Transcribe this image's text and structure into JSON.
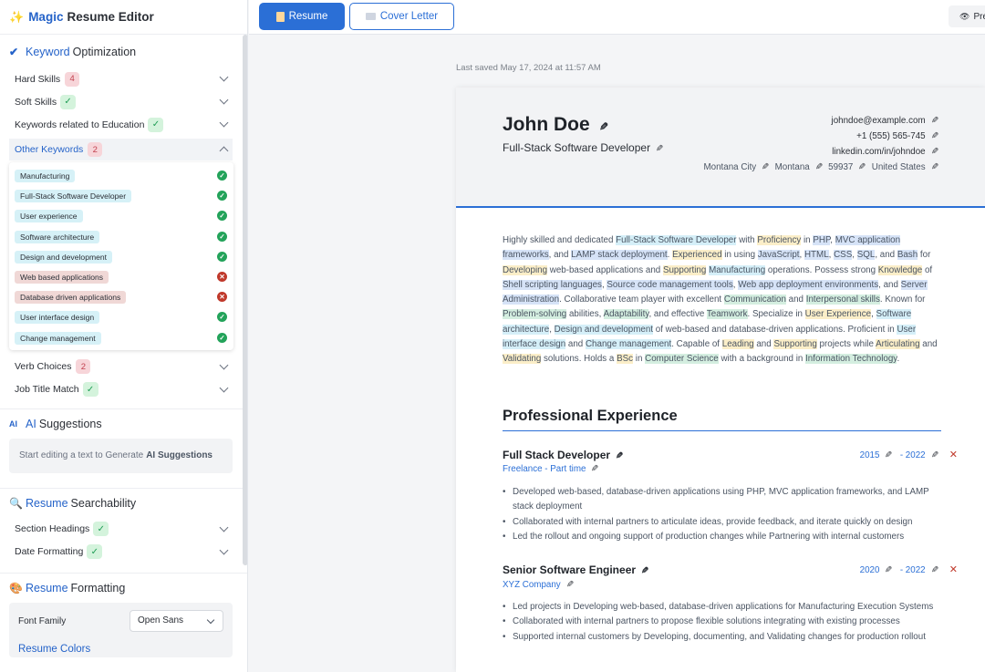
{
  "brand": {
    "prefix": "Magic",
    "rest": "Resume Editor"
  },
  "keyword_section": {
    "title_blue": "Keyword",
    "title_rest": "Optimization",
    "items": [
      {
        "label": "Hard Skills",
        "badge": "4",
        "status": "count"
      },
      {
        "label": "Soft Skills",
        "badge": "✓",
        "status": "ok"
      },
      {
        "label": "Keywords related to Education",
        "badge": "✓",
        "status": "ok"
      },
      {
        "label": "Other Keywords",
        "badge": "2",
        "status": "count",
        "expanded": true
      }
    ],
    "other_keywords": [
      {
        "tag": "Manufacturing",
        "ok": true
      },
      {
        "tag": "Full-Stack Software Developer",
        "ok": true
      },
      {
        "tag": "User experience",
        "ok": true
      },
      {
        "tag": "Software architecture",
        "ok": true
      },
      {
        "tag": "Design and development",
        "ok": true
      },
      {
        "tag": "Web based applications",
        "ok": false
      },
      {
        "tag": "Database driven applications",
        "ok": false
      },
      {
        "tag": "User interface design",
        "ok": true
      },
      {
        "tag": "Change management",
        "ok": true
      }
    ],
    "after_items": [
      {
        "label": "Verb Choices",
        "badge": "2",
        "status": "count"
      },
      {
        "label": "Job Title Match",
        "badge": "✓",
        "status": "ok"
      }
    ]
  },
  "ai_section": {
    "title_blue": "AI",
    "title_rest": "Suggestions",
    "hint": "Start editing a text to Generate",
    "hint_bold": "AI Suggestions"
  },
  "search_section": {
    "title_blue": "Resume",
    "title_rest": "Searchability",
    "items": [
      {
        "label": "Section Headings",
        "badge": "✓"
      },
      {
        "label": "Date Formatting",
        "badge": "✓"
      }
    ]
  },
  "format_section": {
    "title_blue": "Resume",
    "title_rest": "Formatting",
    "font_family_label": "Font Family",
    "font_family_value": "Open Sans",
    "colors_label": "Resume Colors"
  },
  "topbar": {
    "resume_tab": "Resume",
    "cover_tab": "Cover Letter",
    "preview": "Pre"
  },
  "last_saved": "Last saved May 17, 2024 at 11:57 AM",
  "resume": {
    "name": "John Doe",
    "role": "Full-Stack Software Developer",
    "email": "johndoe@example.com",
    "phone": "+1 (555) 565-745",
    "linkedin": "linkedin.com/in/johndoe",
    "city": "Montana City",
    "state": "Montana",
    "zip": "59937",
    "country": "United States",
    "experience_heading": "Professional Experience",
    "jobs": [
      {
        "title": "Full Stack Developer",
        "company": "Freelance - Part time",
        "start": "2015",
        "end": "- 2022",
        "bullets": [
          "Developed web-based, database-driven applications using PHP, MVC application frameworks, and LAMP stack deployment",
          "Collaborated with internal partners to articulate ideas, provide feedback, and iterate quickly on design",
          "Led the rollout and ongoing support of production changes while Partnering with internal customers"
        ]
      },
      {
        "title": "Senior Software Engineer",
        "company": "XYZ Company",
        "start": "2020",
        "end": "- 2022",
        "bullets": [
          "Led projects in Developing web-based, database-driven applications for Manufacturing Execution Systems",
          "Collaborated with internal partners to propose flexible solutions integrating with existing processes",
          "Supported internal customers by Developing, documenting, and Validating changes for production rollout"
        ]
      }
    ]
  },
  "summary_segments": [
    [
      "Highly skilled and dedicated ",
      ""
    ],
    [
      "Full-Stack Software Developer",
      "c"
    ],
    [
      " with ",
      ""
    ],
    [
      "Proficiency",
      "y"
    ],
    [
      " in ",
      ""
    ],
    [
      "PHP",
      "b"
    ],
    [
      ", ",
      ""
    ],
    [
      "MVC application frameworks",
      "b"
    ],
    [
      ", and ",
      ""
    ],
    [
      "LAMP stack deployment",
      "b"
    ],
    [
      ". ",
      ""
    ],
    [
      "Experienced",
      "y"
    ],
    [
      " in using ",
      ""
    ],
    [
      "JavaScript",
      "b"
    ],
    [
      ", ",
      ""
    ],
    [
      "HTML",
      "b"
    ],
    [
      ", ",
      ""
    ],
    [
      "CSS",
      "b"
    ],
    [
      ", ",
      ""
    ],
    [
      "SQL",
      "b"
    ],
    [
      ", and ",
      ""
    ],
    [
      "Bash",
      "b"
    ],
    [
      " for ",
      ""
    ],
    [
      "Developing",
      "y"
    ],
    [
      " web-based applications and ",
      ""
    ],
    [
      "Supporting",
      "y"
    ],
    [
      " ",
      ""
    ],
    [
      "Manufacturing",
      "c"
    ],
    [
      " operations. Possess strong ",
      ""
    ],
    [
      "Knowledge",
      "y"
    ],
    [
      " of ",
      ""
    ],
    [
      "Shell scripting languages",
      "b"
    ],
    [
      ", ",
      ""
    ],
    [
      "Source code management tools",
      "b"
    ],
    [
      ", ",
      ""
    ],
    [
      "Web app deployment environments",
      "b"
    ],
    [
      ", and ",
      ""
    ],
    [
      "Server Administration",
      "b"
    ],
    [
      ". Collaborative team player with excellent ",
      ""
    ],
    [
      "Communication",
      "g"
    ],
    [
      " and ",
      ""
    ],
    [
      "Interpersonal skills",
      "g"
    ],
    [
      ". Known for ",
      ""
    ],
    [
      "Problem-solving",
      "g"
    ],
    [
      " abilities, ",
      ""
    ],
    [
      "Adaptability",
      "g"
    ],
    [
      ", and effective ",
      ""
    ],
    [
      "Teamwork",
      "g"
    ],
    [
      ". Specialize in ",
      ""
    ],
    [
      "User Experience",
      "y"
    ],
    [
      ", ",
      ""
    ],
    [
      "Software architecture",
      "c"
    ],
    [
      ", ",
      ""
    ],
    [
      "Design and development",
      "c"
    ],
    [
      " of web-based and database-driven applications. Proficient in ",
      ""
    ],
    [
      "User interface design",
      "c"
    ],
    [
      " and ",
      ""
    ],
    [
      "Change management",
      "c"
    ],
    [
      ". Capable of ",
      ""
    ],
    [
      "Leading",
      "y"
    ],
    [
      " and ",
      ""
    ],
    [
      "Supporting",
      "y"
    ],
    [
      " projects while ",
      ""
    ],
    [
      "Articulating",
      "y"
    ],
    [
      " and ",
      ""
    ],
    [
      "Validating",
      "y"
    ],
    [
      " solutions. Holds a ",
      ""
    ],
    [
      "BSc",
      "y"
    ],
    [
      " in ",
      ""
    ],
    [
      "Computer Science",
      "g"
    ],
    [
      " with a background in ",
      ""
    ],
    [
      "Information Technology",
      "g"
    ],
    [
      ".",
      ""
    ]
  ],
  "colors": {
    "accent": "#2b6fd6",
    "ok": "#23a35a",
    "bad": "#c0392b"
  }
}
